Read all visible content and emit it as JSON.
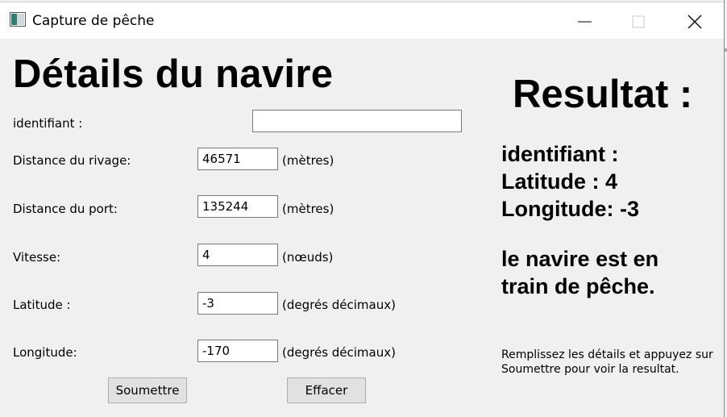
{
  "window": {
    "title": "Capture de pêche",
    "controls": [
      "minimize-icon",
      "maximize-icon",
      "close-icon"
    ]
  },
  "form": {
    "heading": "Détails du navire",
    "fields": [
      {
        "label": "identifiant :",
        "value": "",
        "unit": ""
      },
      {
        "label": "Distance du rivage:",
        "value": "46571",
        "unit": "(mètres)"
      },
      {
        "label": "Distance du port:",
        "value": "135244",
        "unit": "(mètres)"
      },
      {
        "label": "Vitesse:",
        "value": "4",
        "unit": "(nœuds)"
      },
      {
        "label": "Latitude :",
        "value": "-3",
        "unit": "(degrés décimaux)"
      },
      {
        "label": "Longitude:",
        "value": "-170",
        "unit": "(degrés décimaux)"
      }
    ],
    "submit_label": "Soumettre",
    "clear_label": "Effacer"
  },
  "result": {
    "title": "Resultat :",
    "identifiant": "identifiant :",
    "latitude": "Latitude : 4",
    "longitude": "Longitude: -3",
    "message": "le navire est en train de pêche.",
    "hint": "Remplissez les détails et appuyez sur Soumettre pour voir la resultat."
  }
}
